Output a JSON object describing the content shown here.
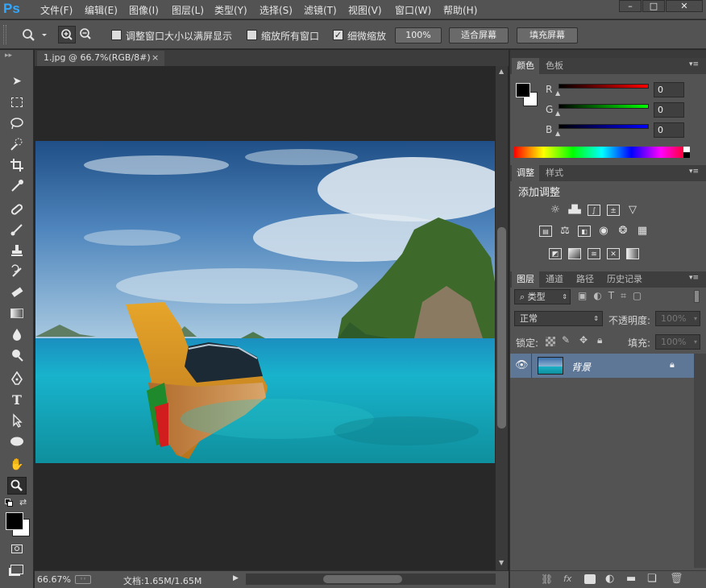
{
  "app": {
    "logo": "Ps"
  },
  "menu": [
    "文件(F)",
    "编辑(E)",
    "图像(I)",
    "图层(L)",
    "类型(Y)",
    "选择(S)",
    "滤镜(T)",
    "视图(V)",
    "窗口(W)",
    "帮助(H)"
  ],
  "window_controls": {
    "minimize": "–",
    "maximize": "□",
    "close": "✕"
  },
  "options": {
    "resize_windows_label": "调整窗口大小以满屏显示",
    "zoom_all_label": "缩放所有窗口",
    "scrubby_zoom_label": "细微缩放",
    "scrubby_checked": true,
    "btn_100": "100%",
    "btn_fit": "适合屏幕",
    "btn_fill": "填充屏幕"
  },
  "document": {
    "tab_title": "1.jpg @ 66.7%(RGB/8#)",
    "close": "×",
    "zoom": "66.67%",
    "doc_info": "文档:1.65M/1.65M"
  },
  "color_panel": {
    "tabs": [
      "颜色",
      "色板"
    ],
    "r_label": "R",
    "g_label": "G",
    "b_label": "B",
    "r_value": "0",
    "g_value": "0",
    "b_value": "0"
  },
  "adjust_panel": {
    "tabs": [
      "调整",
      "样式"
    ],
    "title": "添加调整"
  },
  "layers_panel": {
    "tabs": [
      "图层",
      "通道",
      "路径",
      "历史记录"
    ],
    "filter_kind": "类型",
    "blend_mode": "正常",
    "opacity_label": "不透明度:",
    "opacity_value": "100%",
    "lock_label": "锁定:",
    "fill_label": "填充:",
    "fill_value": "100%",
    "layers": [
      {
        "name": "背景",
        "visible": true,
        "locked": true
      }
    ]
  },
  "colors": {
    "accent": "#31a8ff",
    "ui_bg": "#535353",
    "selected_layer": "#5e7797"
  }
}
